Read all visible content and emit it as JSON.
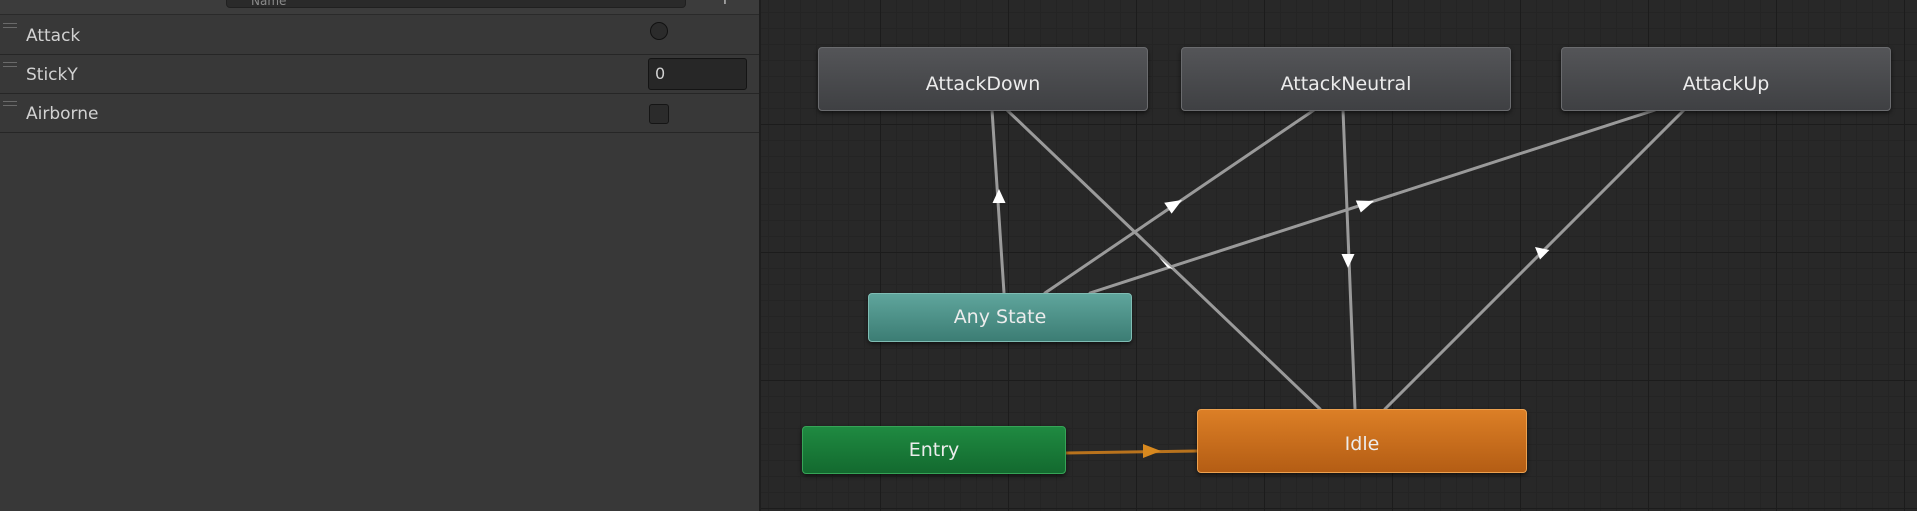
{
  "parameters": {
    "search_placeholder": "Name",
    "add_label": "+",
    "items": [
      {
        "name": "Attack",
        "type": "trigger"
      },
      {
        "name": "StickY",
        "type": "float",
        "value": "0"
      },
      {
        "name": "Airborne",
        "type": "bool",
        "checked": false
      }
    ]
  },
  "graph": {
    "states": {
      "attack_down": "AttackDown",
      "attack_neutral": "AttackNeutral",
      "attack_up": "AttackUp",
      "any_state": "Any State",
      "entry": "Entry",
      "idle": "Idle"
    },
    "transitions": [
      {
        "from": "Any State",
        "to": "AttackDown"
      },
      {
        "from": "Any State",
        "to": "AttackNeutral"
      },
      {
        "from": "Any State",
        "to": "AttackUp"
      },
      {
        "from": "AttackDown",
        "to": "Idle"
      },
      {
        "from": "AttackNeutral",
        "to": "Idle"
      },
      {
        "from": "AttackUp",
        "to": "Idle"
      },
      {
        "from": "Entry",
        "to": "Idle",
        "default": true
      }
    ]
  },
  "colors": {
    "default_state": "#d57a24",
    "entry_state": "#1b7f3b",
    "any_state": "#4f948b",
    "normal_state": "#4a4b4e",
    "transition": "#9a9a9a",
    "default_transition": "#b9731d"
  }
}
